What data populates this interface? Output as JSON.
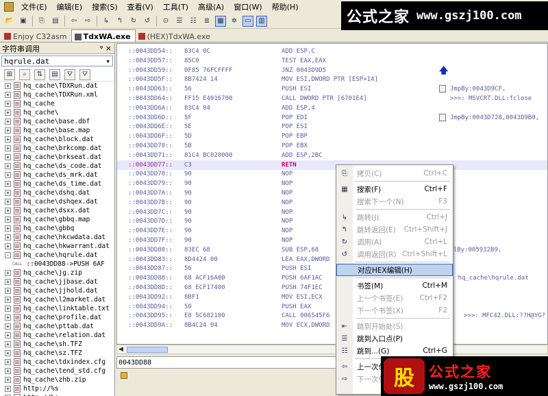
{
  "menubar": [
    "文件(E)",
    "编辑(E)",
    "搜索(S)",
    "查看(V)",
    "工具(T)",
    "高级(A)",
    "窗口(W)",
    "帮助(H)"
  ],
  "tabs": [
    {
      "label": "Enjoy C32asm",
      "active": false
    },
    {
      "label": "TdxWA.exe",
      "active": true
    },
    {
      "label": "(HEX)TdxWA.exe",
      "active": false
    }
  ],
  "logo": {
    "cn": "公式之家",
    "url": "www.gszj100.com"
  },
  "left_panel": {
    "title": "字符串调用",
    "pin": "ᵠ ×",
    "combo_value": "hqrule.dat",
    "items": [
      {
        "type": "file",
        "exp": "+",
        "text": "hq_cache\\TDXRun.dat"
      },
      {
        "type": "file",
        "exp": "+",
        "text": "hq_cache\\TDXRun.xml"
      },
      {
        "type": "file",
        "exp": "+",
        "text": "hq_cache"
      },
      {
        "type": "file",
        "exp": "+",
        "text": "hq_cache\\"
      },
      {
        "type": "file",
        "exp": "+",
        "text": "hq_cache\\base.dbf"
      },
      {
        "type": "file",
        "exp": "+",
        "text": "hq_cache\\base.map"
      },
      {
        "type": "file",
        "exp": "+",
        "text": "hq_cache\\block.dat"
      },
      {
        "type": "file",
        "exp": "+",
        "text": "hq_cache\\brkcomp.dat"
      },
      {
        "type": "file",
        "exp": "+",
        "text": "hq_cache\\brkseat.dat"
      },
      {
        "type": "file",
        "exp": "+",
        "text": "hq_cache\\ds_code.dat"
      },
      {
        "type": "file",
        "exp": "+",
        "text": "hq_cache\\ds_mrk.dat"
      },
      {
        "type": "file",
        "exp": "+",
        "text": "hq_cache\\ds_time.dat"
      },
      {
        "type": "file",
        "exp": "+",
        "text": "hq_cache\\dshq.dat"
      },
      {
        "type": "file",
        "exp": "+",
        "text": "hq_cache\\dshqex.dat"
      },
      {
        "type": "file",
        "exp": "+",
        "text": "hq_cache\\dsxx.dat"
      },
      {
        "type": "file",
        "exp": "+",
        "text": "hq_cache\\gbbq.map"
      },
      {
        "type": "file",
        "exp": "+",
        "text": "hq_cache\\gbbq"
      },
      {
        "type": "file",
        "exp": "+",
        "text": "hq_cache\\hkcwdata.dat"
      },
      {
        "type": "file",
        "exp": "+",
        "text": "hq_cache\\hkwarrant.dat"
      },
      {
        "type": "file",
        "exp": "-",
        "text": "hq_cache\\hqrule.dat"
      },
      {
        "type": "call",
        "exp": "",
        "text": "::0043DD88->PUSH 6AF"
      },
      {
        "type": "file",
        "exp": "+",
        "text": "hq_cache\\jg.zip"
      },
      {
        "type": "file",
        "exp": "+",
        "text": "hq_cache\\jjbase.dat"
      },
      {
        "type": "file",
        "exp": "+",
        "text": "hq_cache\\jjhold.dat"
      },
      {
        "type": "file",
        "exp": "+",
        "text": "hq_cache\\l2market.dat"
      },
      {
        "type": "file",
        "exp": "+",
        "text": "hq_cache\\linktable.txt"
      },
      {
        "type": "file",
        "exp": "+",
        "text": "hq_cache\\profile.dat"
      },
      {
        "type": "file",
        "exp": "+",
        "text": "hq_cache\\pttab.dat"
      },
      {
        "type": "file",
        "exp": "+",
        "text": "hq_cache\\relation.dat"
      },
      {
        "type": "file",
        "exp": "+",
        "text": "hq_cache\\sh.TFZ"
      },
      {
        "type": "file",
        "exp": "+",
        "text": "hq_cache\\sz.TFZ"
      },
      {
        "type": "file",
        "exp": "+",
        "text": "hq_cache\\tdxindex.cfg"
      },
      {
        "type": "file",
        "exp": "+",
        "text": "hq_cache\\tend_std.cfg"
      },
      {
        "type": "file",
        "exp": "+",
        "text": "hq_cache\\zhb.zip"
      },
      {
        "type": "file",
        "exp": "+",
        "text": "http://%s"
      },
      {
        "type": "file",
        "exp": "+",
        "text": "http://%s"
      }
    ]
  },
  "code_rows": [
    {
      "addr": "::0043DD54::",
      "hex": "83C4 0C",
      "asm": "ADD ESP,C",
      "cmt": ""
    },
    {
      "addr": "::0043DD57::",
      "hex": "85C0",
      "asm": "TEST EAX,EAX",
      "cmt": ""
    },
    {
      "addr": "::0043DD59::",
      "hex": "0F85 76FCFFFF",
      "asm": "JNZ 0043D9D5",
      "cmt": ""
    },
    {
      "addr": "::0043DD5F::",
      "hex": "8B7424 14",
      "asm": "MOV ESI,DWORD PTR [ESP+14]",
      "cmt": ""
    },
    {
      "addr": "::0043DD63::",
      "hex": "56",
      "asm": "PUSH ESI",
      "cmt": "JmpBy:0043D9CF,"
    },
    {
      "addr": "::0043DD64::",
      "hex": "FF15 E4016700",
      "asm": "CALL DWORD PTR [6701E4]",
      "cmt": ">>>: MSVCRT.DLL:fclose"
    },
    {
      "addr": "::0043DD6A::",
      "hex": "83C4 04",
      "asm": "ADD ESP,4",
      "cmt": ""
    },
    {
      "addr": "::0043DD6D::",
      "hex": "5F",
      "asm": "POP EDI",
      "cmt": "JmpBy:0043D728,0043D9B0,"
    },
    {
      "addr": "::0043DD6E::",
      "hex": "5E",
      "asm": "POP ESI",
      "cmt": ""
    },
    {
      "addr": "::0043DD6F::",
      "hex": "5D",
      "asm": "POP EBP",
      "cmt": ""
    },
    {
      "addr": "::0043DD70::",
      "hex": "5B",
      "asm": "POP EBX",
      "cmt": ""
    },
    {
      "addr": "::0043DD71::",
      "hex": "81C4 BC020000",
      "asm": "ADD ESP,2BC",
      "cmt": ""
    },
    {
      "addr": "::0043DD77::",
      "hex": "C3",
      "asm": "RETN",
      "cmt": ""
    },
    {
      "addr": "::0043DD78::",
      "hex": "90",
      "asm": "NOP",
      "cmt": ""
    },
    {
      "addr": "::0043DD79::",
      "hex": "90",
      "asm": "NOP",
      "cmt": ""
    },
    {
      "addr": "::0043DD7A::",
      "hex": "90",
      "asm": "NOP",
      "cmt": ""
    },
    {
      "addr": "::0043DD7B::",
      "hex": "90",
      "asm": "NOP",
      "cmt": ""
    },
    {
      "addr": "::0043DD7C::",
      "hex": "90",
      "asm": "NOP",
      "cmt": ""
    },
    {
      "addr": "::0043DD7D::",
      "hex": "90",
      "asm": "NOP",
      "cmt": ""
    },
    {
      "addr": "::0043DD7E::",
      "hex": "90",
      "asm": "NOP",
      "cmt": ""
    },
    {
      "addr": "::0043DD7F::",
      "hex": "90",
      "asm": "NOP",
      "cmt": ""
    },
    {
      "addr": "::0043DD80::",
      "hex": "83EC 68",
      "asm": "SUB ESP,68",
      "cmt": "allBy:005932B9,"
    },
    {
      "addr": "::0043DD83::",
      "hex": "8D4424 00",
      "asm": "LEA EAX,DWORD",
      "cmt": ""
    },
    {
      "addr": "::0043DD87::",
      "hex": "56",
      "asm": "PUSH ESI",
      "cmt": ""
    },
    {
      "addr": "::0043DD88::",
      "hex": "68 ACF16A00",
      "asm": "PUSH 6AF1AC",
      "cmt": "->: hq_cache\\hqrule.dat"
    },
    {
      "addr": "::0043DD8D::",
      "hex": "68 ECF17400",
      "asm": "PUSH 74F1EC",
      "cmt": ""
    },
    {
      "addr": "::0043DD92::",
      "hex": "8BF1",
      "asm": "MOV ESI,ECX",
      "cmt": ""
    },
    {
      "addr": "::0043DD94::",
      "hex": "50",
      "asm": "PUSH EAX",
      "cmt": ""
    },
    {
      "addr": "::0043DD95::",
      "hex": "E8 5C682100",
      "asm": "CALL 006545F6",
      "cmt": ">>>: MFC42.DLL:??H@YG?"
    },
    {
      "addr": "::0043DD9A::",
      "hex": "8B4C24 04",
      "asm": "MOV ECX,DWORD",
      "cmt": ""
    }
  ],
  "statusline": "0043DD88",
  "context_menu": [
    {
      "label": "拷贝(C)",
      "shortcut": "Ctrl+C",
      "disabled": true,
      "icon": "copy-icon",
      "glyph": "⎘"
    },
    {
      "sep": true
    },
    {
      "label": "搜索(F)",
      "shortcut": "Ctrl+F",
      "disabled": false,
      "icon": "search-icon",
      "glyph": "▦"
    },
    {
      "label": "搜索下一个(N)",
      "shortcut": "F3",
      "disabled": true,
      "icon": "",
      "glyph": ""
    },
    {
      "sep": true
    },
    {
      "label": "跳转(J)",
      "shortcut": "Ctrl+J",
      "disabled": true,
      "icon": "jump-icon",
      "glyph": "↳"
    },
    {
      "label": "跳转返回(E)",
      "shortcut": "Ctrl+Shift+J",
      "disabled": true,
      "icon": "jump-back-icon",
      "glyph": "↰"
    },
    {
      "label": "调用(A)",
      "shortcut": "Ctrl+L",
      "disabled": true,
      "icon": "call-icon",
      "glyph": "↻"
    },
    {
      "label": "调用返回(R)",
      "shortcut": "Ctrl+Shift+L",
      "disabled": true,
      "icon": "call-back-icon",
      "glyph": "↺"
    },
    {
      "sep": true
    },
    {
      "label": "对应HEX编辑(H)",
      "shortcut": "",
      "disabled": false,
      "highlight": true,
      "icon": "",
      "glyph": ""
    },
    {
      "sep": true
    },
    {
      "label": "书签(M)",
      "shortcut": "Ctrl+M",
      "disabled": false,
      "icon": "",
      "glyph": ""
    },
    {
      "label": "上一个书签(E)",
      "shortcut": "Ctrl+F2",
      "disabled": true,
      "icon": "",
      "glyph": ""
    },
    {
      "label": "下一个书签(X)",
      "shortcut": "F2",
      "disabled": true,
      "icon": "",
      "glyph": ""
    },
    {
      "sep": true
    },
    {
      "label": "跳到开始处(S)",
      "shortcut": "",
      "disabled": true,
      "icon": "goto-start-icon",
      "glyph": "⇤"
    },
    {
      "label": "跳到入口点(P)",
      "shortcut": "",
      "disabled": false,
      "icon": "entry-point-icon",
      "glyph": "☰"
    },
    {
      "label": "跳到...(G)",
      "shortcut": "Ctrl+G",
      "disabled": false,
      "icon": "goto-icon",
      "glyph": "☷"
    },
    {
      "sep": true
    },
    {
      "label": "上一次位",
      "shortcut": "",
      "disabled": false,
      "icon": "back-arrow-icon",
      "glyph": "⇦"
    },
    {
      "label": "下一次位",
      "shortcut": "",
      "disabled": true,
      "icon": "forward-arrow-icon",
      "glyph": "⇨"
    }
  ],
  "badge": {
    "gu": "股",
    "cn": "公式之家",
    "url": "www.gszj100.com"
  }
}
